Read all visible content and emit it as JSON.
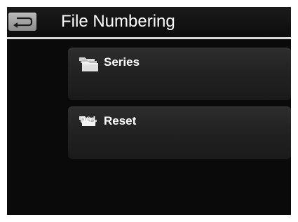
{
  "header": {
    "title": "File Numbering",
    "back_icon": "back-arrow-icon"
  },
  "options": [
    {
      "label": "Series",
      "icon": "folders-icon"
    },
    {
      "label": "Reset",
      "icon": "folders-001-icon",
      "icon_badge": "001"
    }
  ]
}
